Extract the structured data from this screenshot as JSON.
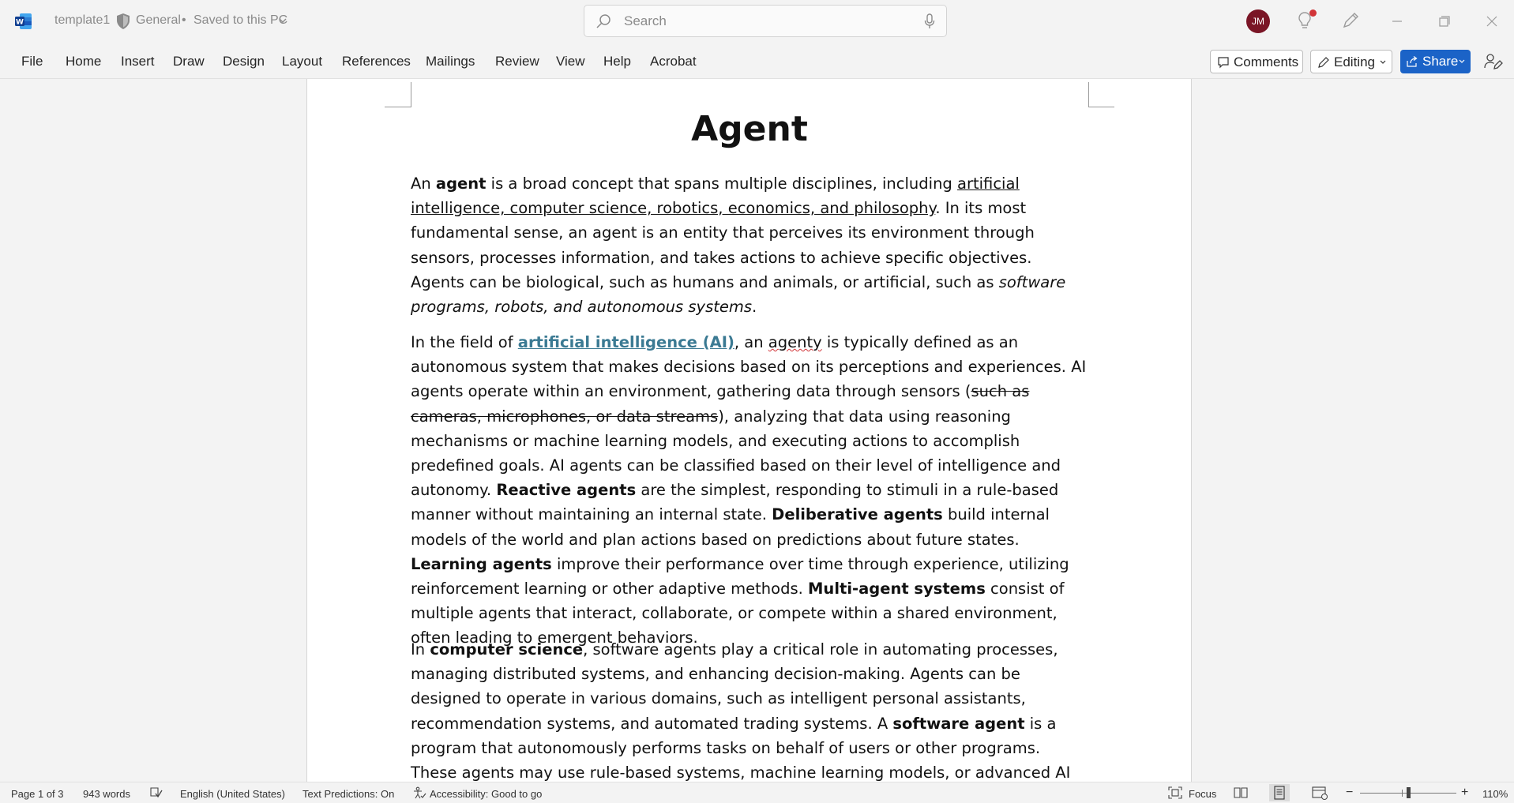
{
  "titlebar": {
    "doc_name": "template1",
    "sensitivity": "General",
    "separator": "•",
    "save_status": "Saved to this PC",
    "search_placeholder": "Search",
    "avatar_initials": "JM"
  },
  "ribbon": {
    "tabs": [
      "File",
      "Home",
      "Insert",
      "Draw",
      "Design",
      "Layout",
      "References",
      "Mailings",
      "Review",
      "View",
      "Help",
      "Acrobat"
    ],
    "comments_label": "Comments",
    "editing_label": "Editing",
    "share_label": "Share"
  },
  "document": {
    "title": "Agent",
    "p1": {
      "t1": "An ",
      "b1": "agent",
      "t2": " is a broad concept that spans multiple disciplines, including ",
      "u1": "artificial intelligence, computer science, robotics, economics, and philosophy",
      "t3": ". In its most fundamental sense, an agent is an entity that perceives its environment through sensors, processes information, and takes actions to achieve specific objectives. Agents can be biological, such as humans and animals, or artificial, such as ",
      "i1": "software programs, robots, and autonomous systems",
      "t4": "."
    },
    "p2": {
      "t1": "In the field of ",
      "link1": "artificial intelligence (AI)",
      "t2": ", an ",
      "misspelled": "agenty",
      "t3": " is typically defined as an autonomous system that makes decisions based on its perceptions and experiences. AI agents operate within an environment, gathering data through sensors (",
      "s1": "such as cameras, microphones, or data streams",
      "t4": "), analyzing that data using reasoning mechanisms or machine learning models, and executing actions to accomplish predefined goals. AI agents can be classified based on their level of intelligence and autonomy. ",
      "b1": "Reactive agents",
      "t5": " are the simplest, responding to stimuli in a rule-based manner without maintaining an internal state. ",
      "b2": "Deliberative agents",
      "t6": " build internal models of the world and plan actions based on predictions about future states. ",
      "b3": "Learning agents",
      "t7": " improve their performance over time through experience, utilizing reinforcement learning or other adaptive methods. ",
      "b4": "Multi-agent systems",
      "t8": " consist of multiple agents that interact, collaborate, or compete within a shared environment, often leading to emergent behaviors."
    },
    "p3": {
      "t1": "In ",
      "b1": "computer science",
      "t2": ", software agents play a critical role in automating processes, managing distributed systems, and enhancing decision-making. Agents can be designed to operate in various domains, such as intelligent personal assistants, recommendation systems, and automated trading systems. A ",
      "b2": "software agent",
      "t3": " is a program that autonomously performs tasks on behalf of users or other programs. These agents may use rule-based systems, machine learning models, or advanced AI techniques to adapt to"
    }
  },
  "statusbar": {
    "page": "Page 1 of 3",
    "words": "943 words",
    "language": "English (United States)",
    "text_predictions": "Text Predictions: On",
    "accessibility": "Accessibility: Good to go",
    "focus": "Focus",
    "zoom_minus": "−",
    "zoom_plus": "+",
    "zoom_level": "110%"
  }
}
